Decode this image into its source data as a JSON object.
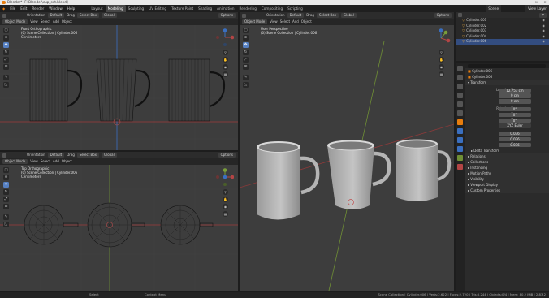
{
  "window": {
    "title": "Blender* [F:\\Blender\\cup_set.blend]",
    "controls": [
      "–",
      "☐",
      "✕"
    ]
  },
  "menu": {
    "items": [
      "File",
      "Edit",
      "Render",
      "Window",
      "Help"
    ],
    "tabs": [
      "Layout",
      "Modeling",
      "Sculpting",
      "UV Editing",
      "Texture Paint",
      "Shading",
      "Animation",
      "Rendering",
      "Compositing",
      "Scripting"
    ],
    "active_tab": "Modeling",
    "scene_label": "Scene",
    "view_layer_label": "View Layer"
  },
  "toolbar_top": {
    "mode": "Object Mode",
    "menus": [
      "View",
      "Select",
      "Add",
      "Object"
    ],
    "orientation_label": "Orientation",
    "orientation_value": "Default",
    "drag_label": "Drag",
    "drag_value": "Select Box",
    "pivot": "Global",
    "options": "Options"
  },
  "viewport_front": {
    "name": "Front Orthographic",
    "collection": "(0) Scene Collection | Cylinder.006",
    "units": "Centimeters"
  },
  "viewport_top": {
    "name": "Top Orthographic",
    "collection": "(0) Scene Collection | Cylinder.006",
    "units": "Centimeters"
  },
  "viewport_persp": {
    "name": "User Perspective",
    "collection": "(0) Scene Collection | Cylinder.006"
  },
  "outliner": {
    "items": [
      "Cylinder.001",
      "Cylinder.002",
      "Cylinder.003",
      "Cylinder.004",
      "Cylinder.006"
    ],
    "selected_index": 4,
    "accent": "#334d80"
  },
  "properties": {
    "object_name": "Cylinder.006",
    "object_data_name": "Cylinder.006",
    "transform_label": "Transform",
    "location": {
      "label": "Location X",
      "x": "12.753 cm",
      "y": "0 cm",
      "z": "0 cm"
    },
    "rotation": {
      "label": "Rotation X",
      "x": "0°",
      "y": "0°",
      "z": "0°"
    },
    "mode_label": "Mode",
    "mode_value": "XYZ Euler",
    "scale": {
      "label": "Scale X",
      "x": "0.036",
      "y": "0.036",
      "z": "0.036"
    },
    "axis_y": "Y",
    "axis_z": "Z",
    "delta": "Delta Transform",
    "sections": [
      "Relations",
      "Collections",
      "Instancing",
      "Motion Paths",
      "Visibility",
      "Viewport Display",
      "Custom Properties"
    ]
  },
  "statusbar": {
    "left": "Select",
    "mid": "Context Menu",
    "right": "Scene Collection | Cylinder.006 | Verts:2,622 | Faces:2,720 | Tris:5,244 | Objects:0/4 | Mem: 80.2 MiB | 2.83.2"
  },
  "colors": {
    "axis_x": "#b34545",
    "axis_y": "#7a9e3a",
    "axis_z": "#3a6fc0",
    "selected_blue": "#5680c2"
  }
}
